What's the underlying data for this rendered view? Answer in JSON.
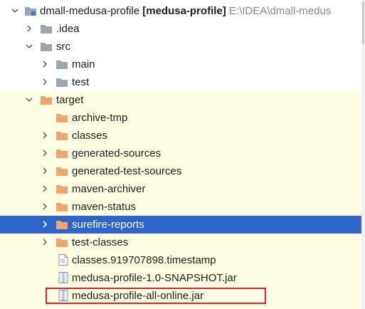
{
  "project": {
    "name": "dmall-medusa-profile",
    "module": "[medusa-profile]",
    "path": "E:\\IDEA\\dmall-medus"
  },
  "tree": {
    "idea": ".idea",
    "src": "src",
    "main": "main",
    "test": "test",
    "target": "target",
    "archive_tmp": "archive-tmp",
    "classes": "classes",
    "generated_sources": "generated-sources",
    "generated_test_sources": "generated-test-sources",
    "maven_archiver": "maven-archiver",
    "maven_status": "maven-status",
    "surefire_reports": "surefire-reports",
    "test_classes": "test-classes",
    "timestamp_file": "classes.919707898.timestamp",
    "snapshot_jar": "medusa-profile-1.0-SNAPSHOT.jar",
    "online_jar": "medusa-profile-all-online.jar"
  },
  "colors": {
    "selection": "#2f65ca",
    "excluded_bg": "#fdfde3",
    "target_folder": "#f0a470",
    "plain_folder": "#9aa7b0",
    "highlight_border": "#e0242b"
  },
  "icons": {
    "expanded": "chevron-down-icon",
    "collapsed": "chevron-right-icon",
    "module": "module-folder-icon",
    "folder": "folder-icon",
    "excluded_folder": "excluded-folder-icon",
    "file": "file-icon",
    "jar": "jar-icon"
  }
}
